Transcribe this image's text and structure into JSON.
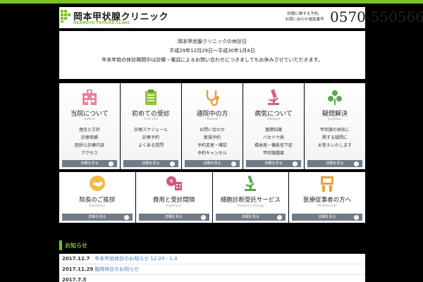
{
  "header": {
    "logo_jp": "岡本甲状腺クリニック",
    "logo_en": "OKAMOTO THYROID CLINIC",
    "tel_note_1": "診療に関する予約、",
    "tel_note_2": "お問い合わせ電話番号",
    "tel_number": "0570-550566",
    "accent": "#7cc41c"
  },
  "notice": {
    "line1": "岡本甲状腺クリニックの休診日",
    "line2": "平成29年12月29日〜平成30年1月4日",
    "line3": "年末年始の休診期間中は診療・電話によるお問い合わせにつきましてもお休みさせていただきます。"
  },
  "menu": [
    {
      "title": "当院について",
      "subtitle": "Outline",
      "items": [
        "理念と方針",
        "診療実績",
        "医師と診療内容",
        "アクセス"
      ],
      "more": "詳細を見る",
      "icon": "hospital-icon"
    },
    {
      "title": "初めての受診",
      "subtitle": "First Visit",
      "items": [
        "診療スケジュール",
        "診察予約",
        "よくある質問"
      ],
      "more": "詳細を見る",
      "icon": "clipboard-icon"
    },
    {
      "title": "通院中の方",
      "subtitle": "Revisit",
      "items": [
        "お問い合わせ",
        "新規予約",
        "予約変更・確認",
        "予約キャンセル"
      ],
      "more": "詳細を見る",
      "icon": "stethoscope-icon"
    },
    {
      "title": "病気について",
      "subtitle": "Disease",
      "items": [
        "基礎知識",
        "バセドウ病",
        "橋本病・機能低下症",
        "甲状腺腫瘍"
      ],
      "more": "詳細を見る",
      "icon": "microscope-icon"
    },
    {
      "title": "疑問解決",
      "subtitle": "Question",
      "items": [
        "甲状腺の病気に",
        "関する疑問に",
        "お答えいたします"
      ],
      "more": "詳細を見る",
      "icon": "question-icon"
    }
  ],
  "menu2": [
    {
      "title": "院長のご挨拶",
      "subtitle": "Salutation",
      "more": "詳細を見る",
      "icon": "handshake-icon"
    },
    {
      "title": "費用と受診間隔",
      "subtitle": "Expenses",
      "more": "詳細を見る",
      "icon": "yen-calendar-icon"
    },
    {
      "title": "細胞診断受託サービス",
      "subtitle": "Thyroid Cytology",
      "more": "詳細を見る",
      "icon": "microscope-icon"
    },
    {
      "title": "医療従事者の方へ",
      "subtitle": "Professional",
      "more": "詳細を見る",
      "icon": "presentation-icon"
    }
  ],
  "news": {
    "heading": "お知らせ",
    "items": [
      {
        "date": "2017.12.7",
        "text": "年末年始休診のお知らせ 12.29 - 1.4"
      },
      {
        "date": "2017.11.29",
        "text": "臨時休診のお知らせ"
      },
      {
        "date": "2017.7.5",
        "text": ""
      }
    ]
  }
}
